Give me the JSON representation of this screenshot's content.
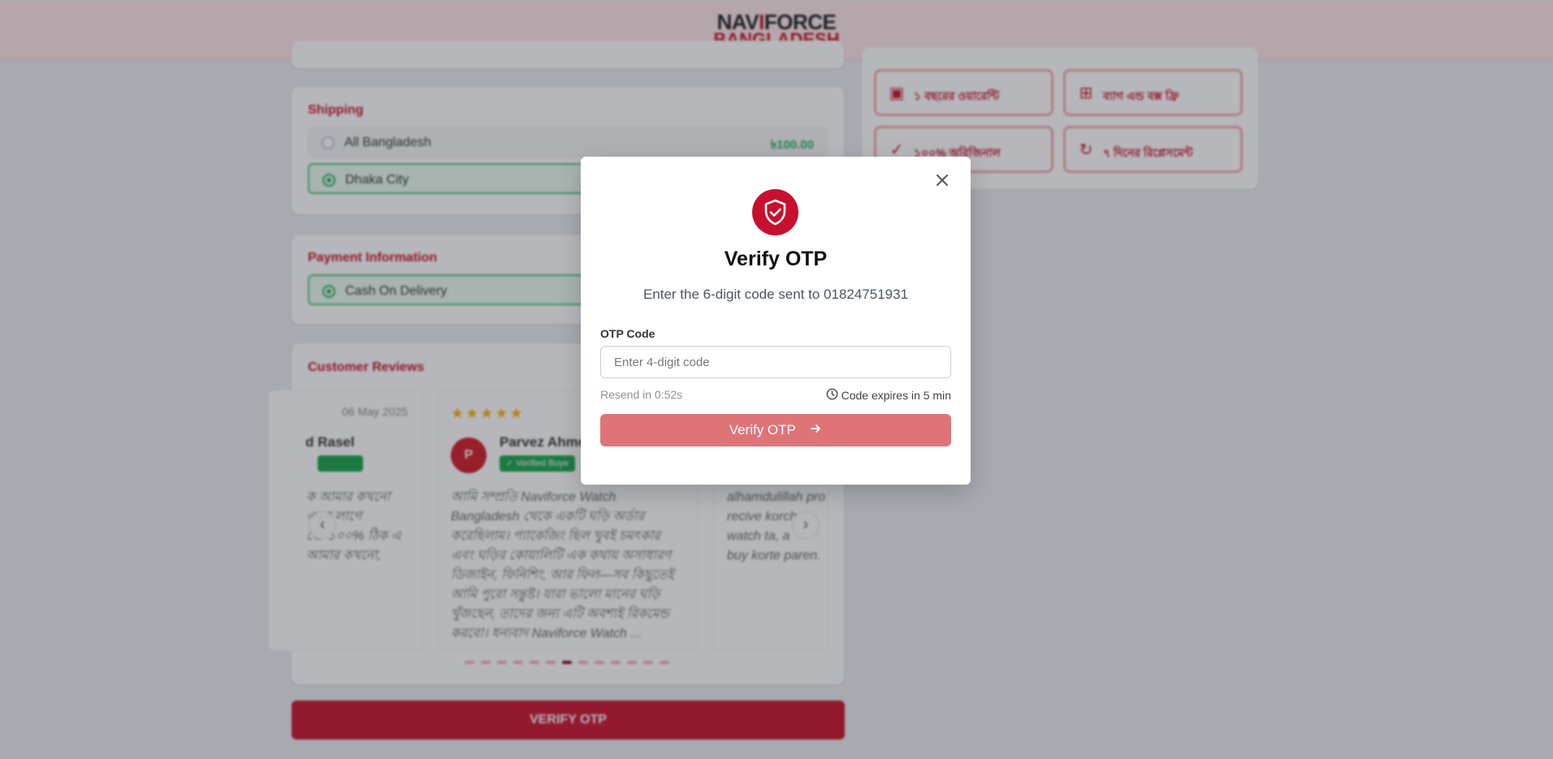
{
  "brand": {
    "line1_a": "NAV",
    "line1_b": "I",
    "line1_c": "FORCE",
    "line2": "BANGLADESH"
  },
  "shipping": {
    "title": "Shipping",
    "options": [
      {
        "label": "All Bangladesh",
        "price": "৳100.00",
        "selected": false
      },
      {
        "label": "Dhaka City",
        "price": "",
        "selected": true
      }
    ]
  },
  "payment": {
    "title": "Payment Information",
    "options": [
      {
        "label": "Cash On Delivery",
        "selected": true
      }
    ]
  },
  "features": [
    {
      "icon": "wallet-icon",
      "label": "১ বছরের ওয়ারেন্টি"
    },
    {
      "icon": "gift-icon",
      "label": "ব্যাগ এন্ড বক্স ফ্রি"
    },
    {
      "icon": "badge-check-icon",
      "label": "১০০% অরিজিনাল"
    },
    {
      "icon": "refresh-icon",
      "label": "৭ দিনের রিপ্লেসমেন্ট"
    }
  ],
  "reviews": {
    "title": "Customer Reviews",
    "items": [
      {
        "name": "d Rasel",
        "date": "06 May 2025",
        "text": "ক আমার কখনো\n এমন লাগে\nে ১০০% ঠিক এ\n আমার কখনো,"
      },
      {
        "initial": "P",
        "name": "Parvez Ahme",
        "badge": "✓ Verified Buye",
        "rating": "★★★★★",
        "text": "আমি সম্প্রতি Naviforce Watch\nBangladesh থেকে একটি ঘড়ি অর্ডার\nকরেছিলাম। প্যাকেজিং ছিল খুবই চমৎকার\nএবং ঘড়ির কোয়ালিটি এক কথায় অসাধারণ\nডিজাইন, ফিনিশিং, আর ফিল—সব কিছুতেই\nআমি পুরো সন্তুষ্ট। যারা ভালো মানের ঘড়ি\nখুঁজছেন, তাদের জন্য এটি অবশ্যই রিকমেন্ড\nকরবো। ধন্যবাদ Naviforce Watch ..."
      },
      {
        "text": "alhamdulillah pro\nrecive korch\nwatch ta, a\nbuy korte paren."
      }
    ],
    "dot_count": 13,
    "active_dot": 6
  },
  "page_button": "VERIFY OTP",
  "modal": {
    "title": "Verify OTP",
    "subtitle": "Enter the 6-digit code sent to 01824751931",
    "field_label": "OTP Code",
    "placeholder": "Enter 4-digit code",
    "resend": "Resend in 0:52s",
    "expires": "Code expires in 5 min",
    "verify_label": "Verify OTP",
    "accent": "#c8102e",
    "button_color": "#de7478"
  }
}
